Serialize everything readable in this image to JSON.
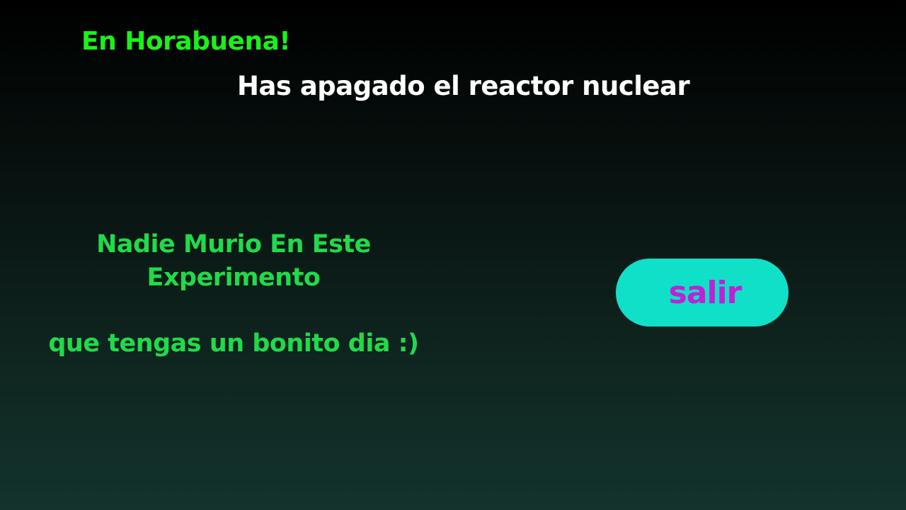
{
  "screen": {
    "congrats_text": "En Horabuena!",
    "subtitle_text": "Has apagado el reactor nuclear",
    "message": {
      "line_1": "Nadie Murio En Este Experimento",
      "line_2": "que tengas un bonito dia :)"
    },
    "exit_button": {
      "label": "salir"
    }
  },
  "colors": {
    "congrats": "#19f219",
    "subtitle": "#ffffff",
    "message": "#22d94a",
    "button_background": "#10e0c8",
    "button_text": "#c21fd6",
    "background_top": "#000000",
    "background_bottom": "#13332c"
  }
}
